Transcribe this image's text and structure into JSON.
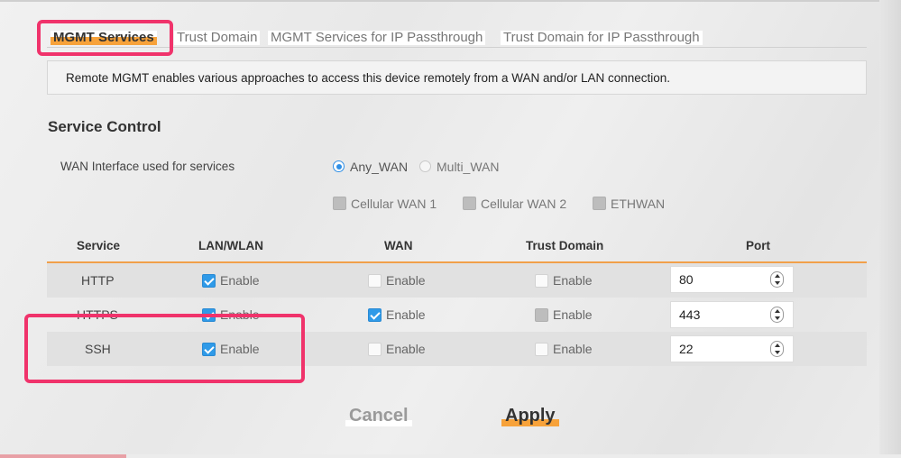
{
  "tabs": [
    {
      "label": "MGMT Services"
    },
    {
      "label": "Trust Domain"
    },
    {
      "label": "MGMT Services for IP Passthrough"
    },
    {
      "label": "Trust Domain for IP Passthrough"
    }
  ],
  "info_text": "Remote MGMT enables various approaches to access this device remotely from a WAN and/or LAN connection.",
  "section_title": "Service Control",
  "wan_interface": {
    "label": "WAN Interface used for services",
    "options": [
      "Any_WAN",
      "Multi_WAN"
    ],
    "selected": "Any_WAN",
    "sub_options": [
      "Cellular WAN 1",
      "Cellular WAN 2",
      "ETHWAN"
    ]
  },
  "table": {
    "headers": [
      "Service",
      "LAN/WLAN",
      "WAN",
      "Trust Domain",
      "Port"
    ],
    "enable_label": "Enable",
    "rows": [
      {
        "service": "HTTP",
        "lan": true,
        "wan": false,
        "trust": false,
        "port": "80"
      },
      {
        "service": "HTTPS",
        "lan": true,
        "wan": true,
        "trust": false,
        "port": "443"
      },
      {
        "service": "SSH",
        "lan": true,
        "wan": false,
        "trust": false,
        "port": "22"
      }
    ]
  },
  "buttons": {
    "cancel": "Cancel",
    "apply": "Apply"
  },
  "colors": {
    "accent": "#f7a23a",
    "highlight": "#f0336b",
    "check": "#2f9ae8"
  }
}
